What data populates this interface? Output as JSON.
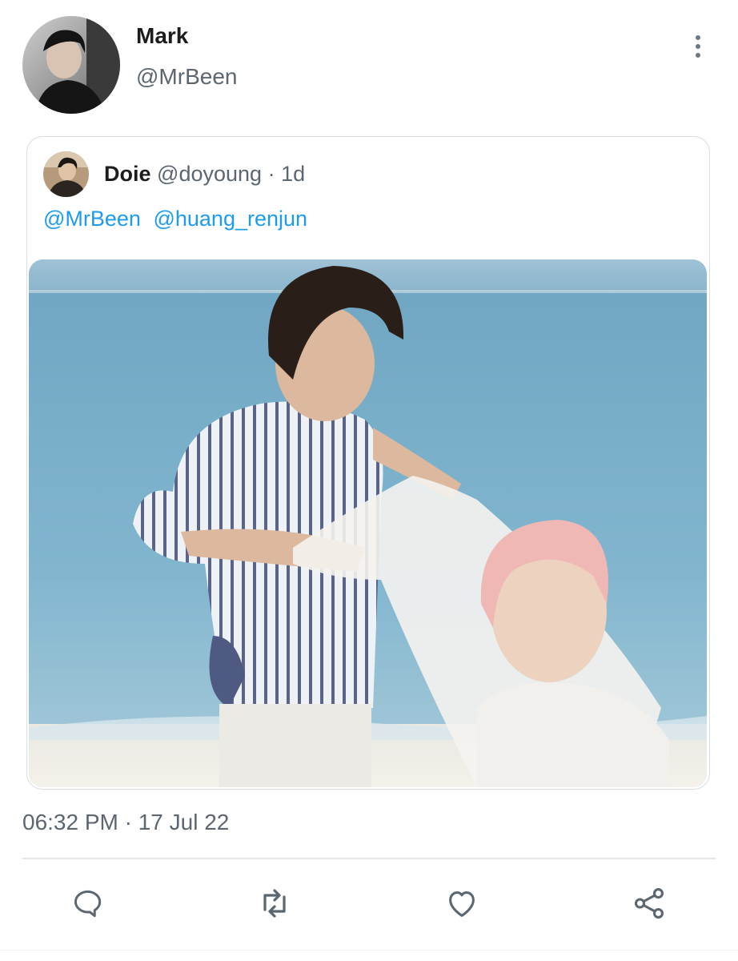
{
  "tweet": {
    "author_name": "Mark",
    "author_handle": "@MrBeen",
    "more_icon": "more-vertical-icon",
    "timestamp": "06:32 PM · 17 Jul 22"
  },
  "quoted_tweet": {
    "author_name": "Doie",
    "author_handle": "@doyoung",
    "separator": "·",
    "age": "1d",
    "mentions": [
      "@MrBeen",
      "@huang_renjun"
    ]
  },
  "actions": [
    {
      "icon": "reply-icon"
    },
    {
      "icon": "retweet-icon"
    },
    {
      "icon": "like-icon"
    },
    {
      "icon": "share-icon"
    }
  ],
  "colors": {
    "link": "#1d9bf0",
    "secondary_text": "#5b6670",
    "icon": "#5b6670",
    "border": "#d6dde3"
  }
}
